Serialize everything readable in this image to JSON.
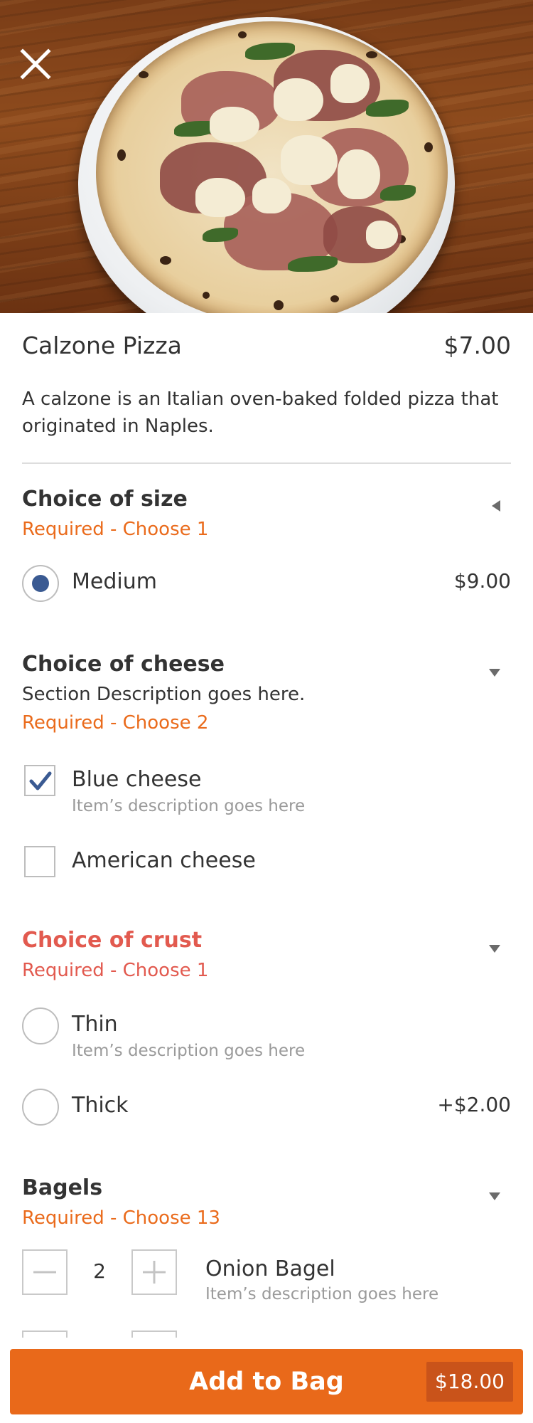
{
  "item": {
    "title": "Calzone Pizza",
    "price": "$7.00",
    "description": "A calzone is an Italian oven-baked folded pizza that originated in Naples."
  },
  "sections": {
    "size": {
      "title": "Choice of size",
      "requirement": "Required - Choose 1",
      "options": [
        {
          "label": "Medium",
          "price": "$9.00",
          "selected": true
        }
      ]
    },
    "cheese": {
      "title": "Choice of cheese",
      "description": "Section Description goes here.",
      "requirement": "Required - Choose 2",
      "options": [
        {
          "label": "Blue cheese",
          "sub": "Item’s description goes here",
          "checked": true
        },
        {
          "label": "American cheese",
          "checked": false
        }
      ]
    },
    "crust": {
      "title": "Choice of crust",
      "requirement": "Required - Choose 1",
      "options": [
        {
          "label": "Thin",
          "sub": "Item’s description goes here",
          "selected": false
        },
        {
          "label": "Thick",
          "price": "+$2.00",
          "selected": false
        }
      ]
    },
    "bagels": {
      "title": "Bagels",
      "requirement": "Required - Choose 13",
      "options": [
        {
          "label": "Onion Bagel",
          "sub": "Item’s description goes here",
          "quantity": "2"
        }
      ]
    }
  },
  "footer": {
    "button_label": "Add to Bag",
    "total": "$18.00"
  },
  "colors": {
    "accent": "#e9691a",
    "error": "#e25a4f",
    "radio_selected": "#3a5a92",
    "muted": "#9a9a9a"
  },
  "icons": [
    "close-icon",
    "chevron-left-icon",
    "chevron-down-icon",
    "checkmark-icon",
    "minus-icon",
    "plus-icon"
  ]
}
